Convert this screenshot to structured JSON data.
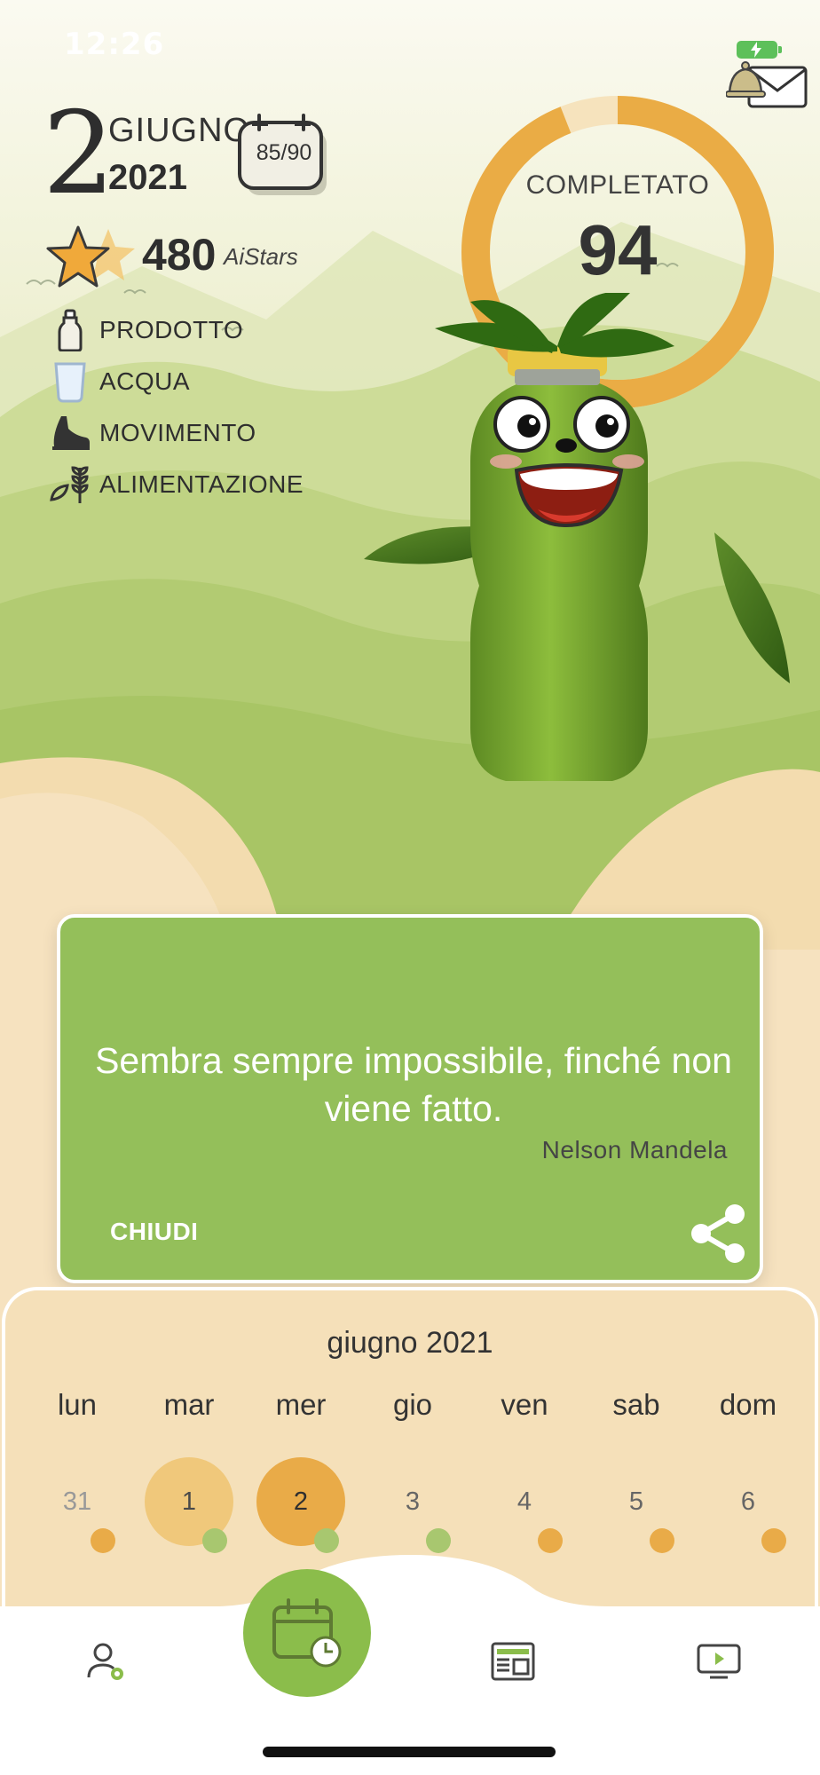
{
  "status_bar": {
    "time": "12:26"
  },
  "header": {
    "day": "2",
    "month": "GIUGNO",
    "year": "2021",
    "day_counter": "85/90"
  },
  "stars": {
    "count": "480",
    "unit": "AiStars"
  },
  "categories": [
    {
      "label": "PRODOTTO",
      "icon": "bottle-icon"
    },
    {
      "label": "ACQUA",
      "icon": "glass-icon"
    },
    {
      "label": "MOVIMENTO",
      "icon": "shoe-icon"
    },
    {
      "label": "ALIMENTAZIONE",
      "icon": "wheat-icon"
    }
  ],
  "progress": {
    "label": "COMPLETATO",
    "value": "94",
    "percent": 94
  },
  "quote": {
    "text": "Sembra sempre impossibile, finché non viene fatto.",
    "author": "Nelson Mandela",
    "close_label": "CHIUDI"
  },
  "calendar": {
    "title": "giugno 2021",
    "days": [
      {
        "weekday": "lun",
        "day": "31",
        "state": "prev",
        "dot": "#e9ab48"
      },
      {
        "weekday": "mar",
        "day": "1",
        "state": "past",
        "dot": "#a8c76f"
      },
      {
        "weekday": "mer",
        "day": "2",
        "state": "today",
        "dot": "#a8c76f"
      },
      {
        "weekday": "gio",
        "day": "3",
        "state": "future",
        "dot": "#a8c76f"
      },
      {
        "weekday": "ven",
        "day": "4",
        "state": "future",
        "dot": "#e9ab48"
      },
      {
        "weekday": "sab",
        "day": "5",
        "state": "future",
        "dot": "#e9ab48"
      },
      {
        "weekday": "dom",
        "day": "6",
        "state": "future",
        "dot": "#e9ab48"
      }
    ]
  },
  "colors": {
    "accent_green": "#94bf5a",
    "accent_orange": "#e9ab48",
    "cream": "#f5e0b9"
  },
  "nav": [
    {
      "name": "profile-tab",
      "icon": "user-settings-icon"
    },
    {
      "name": "calendar-tab",
      "icon": "calendar-clock-icon"
    },
    {
      "name": "news-tab",
      "icon": "newspaper-icon"
    },
    {
      "name": "video-tab",
      "icon": "video-play-icon"
    }
  ]
}
